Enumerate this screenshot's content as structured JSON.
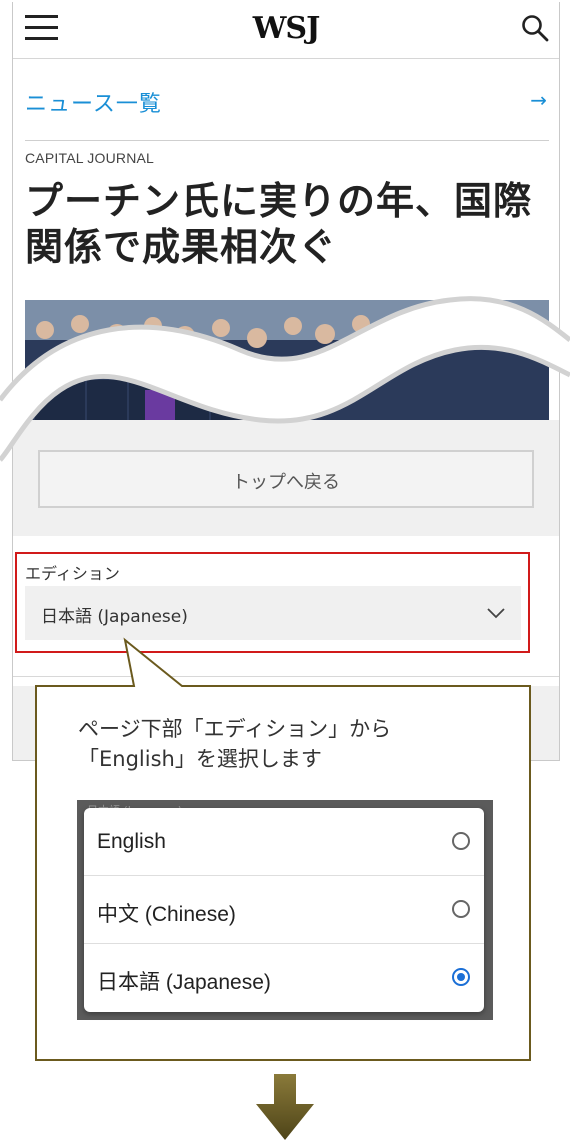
{
  "header": {
    "logo": "WSJ"
  },
  "news_link": {
    "label": "ニュース一覧",
    "arrow": "→"
  },
  "article": {
    "kicker": "CAPITAL JOURNAL",
    "headline_line1": "プーチン氏に実りの年、国際",
    "headline_line2": "関係で成果相次ぐ"
  },
  "back_to_top": {
    "label": "トップへ戻る"
  },
  "edition": {
    "title": "エディション",
    "selected": "日本語 (Japanese)"
  },
  "instruction": {
    "line1": "ページ下部「エディション」から",
    "line2": "「English」を選択します"
  },
  "dialog": {
    "background_ghost": "日本語 (Japanese)",
    "options": [
      {
        "label": "English",
        "selected": false
      },
      {
        "label": "中文 (Chinese)",
        "selected": false
      },
      {
        "label": "日本語 (Japanese)",
        "selected": true
      }
    ]
  },
  "colors": {
    "link": "#1a8fd6",
    "highlight_border": "#d11a1a",
    "callout_border": "#6b5a1e",
    "radio_on": "#1b6fd6"
  }
}
